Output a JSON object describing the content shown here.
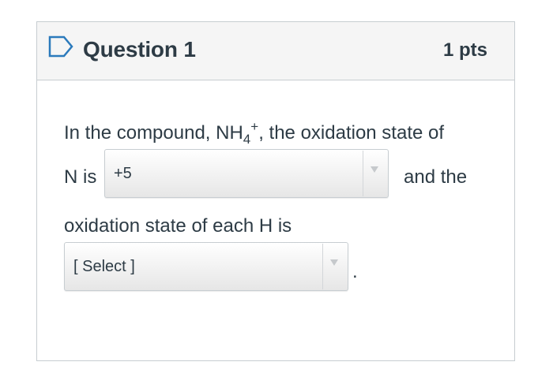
{
  "question": {
    "title": "Question 1",
    "points": "1 pts",
    "line1_prefix": "In the compound, NH",
    "line1_subscript": "4",
    "line1_superscript": "+",
    "line1_suffix": ",  the oxidation state of",
    "line2_prefix": "N is",
    "line2_suffix": "and the",
    "line3": "oxidation state of each H is",
    "trailing_period": "."
  },
  "dropdowns": [
    {
      "selected": "+5"
    },
    {
      "selected": "[ Select ]"
    }
  ],
  "icons": {
    "flag": "bookmark-flag-icon",
    "dropdown_arrow": "chevron-down-icon"
  },
  "colors": {
    "text": "#2d3b45",
    "header_bg": "#f5f5f5",
    "border": "#c7cdd1",
    "flag_stroke": "#2b7abc"
  }
}
